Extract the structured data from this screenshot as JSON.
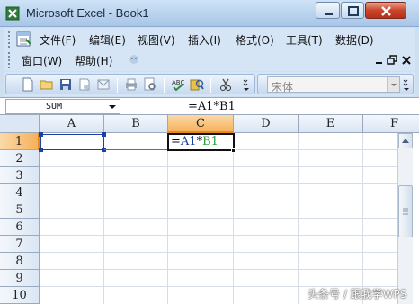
{
  "window": {
    "title": "Microsoft Excel - Book1"
  },
  "menu": {
    "row1": [
      "文件(F)",
      "编辑(E)",
      "视图(V)",
      "插入(I)",
      "格式(O)",
      "工具(T)",
      "数据(D)"
    ],
    "row2": [
      "窗口(W)",
      "帮助(H)"
    ]
  },
  "toolbar": {
    "font_name": "宋体"
  },
  "formula_bar": {
    "name_box": "SUM",
    "formula": "=A1*B1"
  },
  "grid": {
    "columns": [
      "A",
      "B",
      "C",
      "D",
      "E",
      "F"
    ],
    "rows": [
      "1",
      "2",
      "3",
      "4",
      "5",
      "6",
      "7",
      "8",
      "9",
      "10"
    ],
    "active_cell": "C1",
    "cell_c1": {
      "prefix": "=",
      "ref1": "A1",
      "op": "*",
      "ref2": "B1"
    }
  },
  "watermark": "头条号 / 跟我学WPS",
  "colors": {
    "ref_a1": "#1f3fa5",
    "ref_b1": "#2a9a3a",
    "active_header": "#f6b15a"
  }
}
